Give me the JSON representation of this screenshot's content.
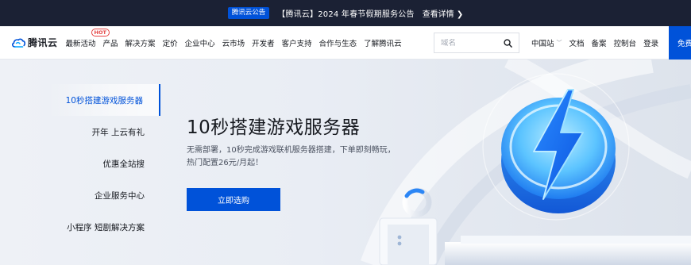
{
  "announcement": {
    "tag": "腾讯云公告",
    "message": "【腾讯云】2024 年春节假期服务公告",
    "more": "查看详情 ❯"
  },
  "nav": {
    "logo_text": "腾讯云",
    "menu": [
      {
        "label": "最新活动",
        "badge": "HOT"
      },
      {
        "label": "产品"
      },
      {
        "label": "解决方案"
      },
      {
        "label": "定价"
      },
      {
        "label": "企业中心"
      },
      {
        "label": "云市场"
      },
      {
        "label": "开发者"
      },
      {
        "label": "客户支持"
      },
      {
        "label": "合作与生态"
      },
      {
        "label": "了解腾讯云"
      }
    ],
    "search_placeholder": "域名",
    "region": "中国站",
    "links": [
      "文档",
      "备案",
      "控制台",
      "登录"
    ],
    "free_button": "免费注册"
  },
  "sidebar": {
    "items": [
      {
        "label": "10秒搭建游戏服务器",
        "active": true
      },
      {
        "label": "开年 上云有礼",
        "active": false
      },
      {
        "label": "优惠全站搜",
        "active": false
      },
      {
        "label": "企业服务中心",
        "active": false
      },
      {
        "label": "小程序 短剧解决方案",
        "active": false
      }
    ]
  },
  "hero": {
    "title": "10秒搭建游戏服务器",
    "description": "无需部署，10秒完成游戏联机服务器搭建，下单即刻畅玩，热门配置26元/月起！",
    "cta": "立即选购"
  },
  "colors": {
    "brand": "#0052d9",
    "announce_bg": "#1b2134",
    "hot": "#e54545"
  }
}
